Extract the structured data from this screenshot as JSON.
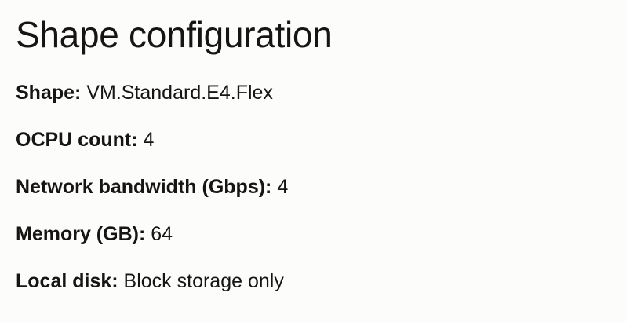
{
  "title": "Shape configuration",
  "details": [
    {
      "label": "Shape:",
      "value": "VM.Standard.E4.Flex"
    },
    {
      "label": "OCPU count:",
      "value": "4"
    },
    {
      "label": "Network bandwidth (Gbps):",
      "value": "4"
    },
    {
      "label": "Memory (GB):",
      "value": "64"
    },
    {
      "label": "Local disk:",
      "value": "Block storage only"
    }
  ]
}
